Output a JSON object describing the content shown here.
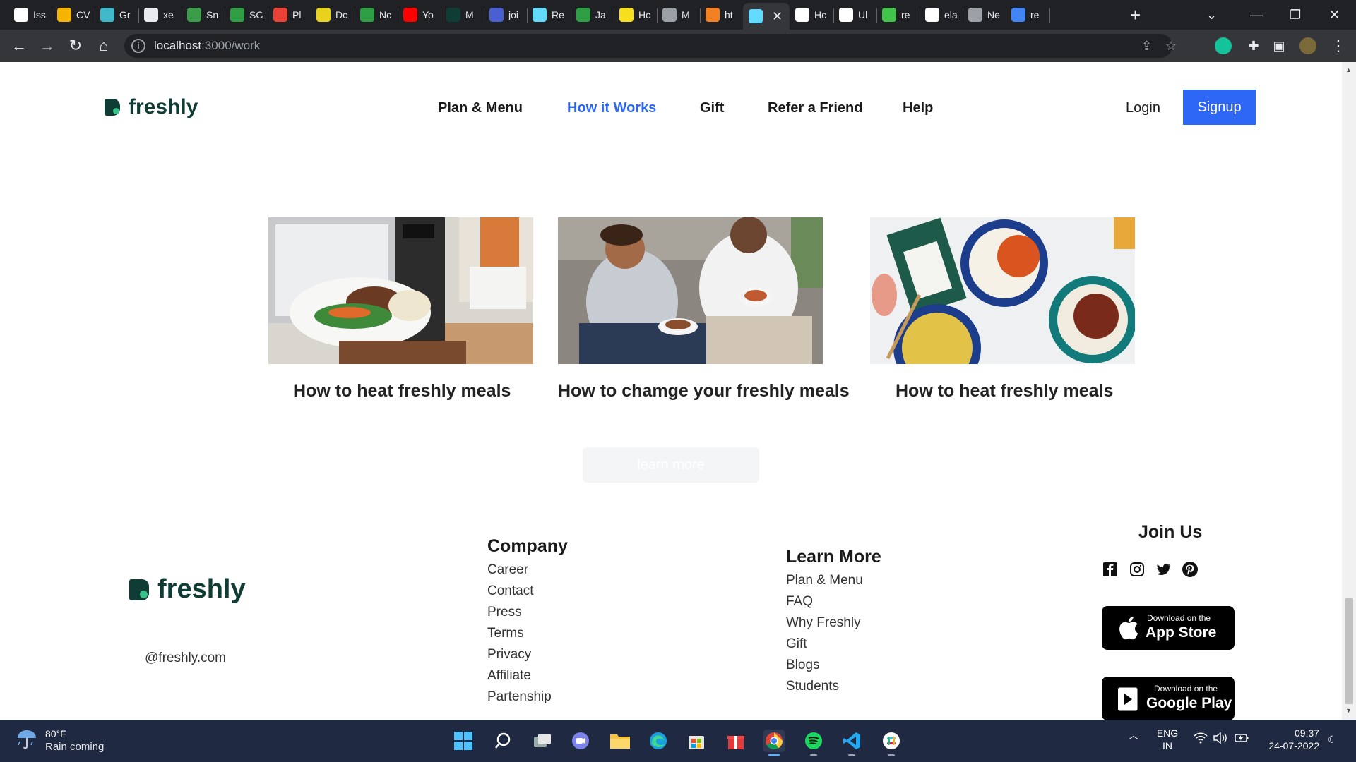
{
  "browser": {
    "tabs": [
      {
        "label": "Iss",
        "icon": "github-icon",
        "color": "#ffffff"
      },
      {
        "label": "CV",
        "icon": "hourglass-icon",
        "color": "#f4b400"
      },
      {
        "label": "Gr",
        "icon": "bolt-icon",
        "color": "#3fb8c9"
      },
      {
        "label": "xe",
        "icon": "square-icon",
        "color": "#e8eaed"
      },
      {
        "label": "Sn",
        "icon": "map-icon",
        "color": "#3b9c4a"
      },
      {
        "label": "SC",
        "icon": "w-icon",
        "color": "#2e9d43"
      },
      {
        "label": "Pl",
        "icon": "gmail-icon",
        "color": "#ea4335"
      },
      {
        "label": "Dc",
        "icon": "download-icon",
        "color": "#e8d21d"
      },
      {
        "label": "Nc",
        "icon": "w-icon",
        "color": "#2e9d43"
      },
      {
        "label": "Yo",
        "icon": "youtube-icon",
        "color": "#ff0000"
      },
      {
        "label": "M",
        "icon": "freshly-icon",
        "color": "#0f3d35"
      },
      {
        "label": "joi",
        "icon": "wifi-icon",
        "color": "#4a5fd1"
      },
      {
        "label": "Re",
        "icon": "react-icon",
        "color": "#61dafb"
      },
      {
        "label": "Ja",
        "icon": "w-icon",
        "color": "#2e9d43"
      },
      {
        "label": "Hc",
        "icon": "js-icon",
        "color": "#f7df1e"
      },
      {
        "label": "M",
        "icon": "globe-icon",
        "color": "#9aa0a6"
      },
      {
        "label": "ht",
        "icon": "stack-icon",
        "color": "#f48024"
      },
      {
        "label": "",
        "icon": "react-icon",
        "color": "#61dafb",
        "active": true
      },
      {
        "label": "Hc",
        "icon": "medium-icon",
        "color": "#ffffff"
      },
      {
        "label": "Ul",
        "icon": "github-icon",
        "color": "#ffffff"
      },
      {
        "label": "re",
        "icon": "spark-icon",
        "color": "#42c44b"
      },
      {
        "label": "ela",
        "icon": "github-icon",
        "color": "#ffffff"
      },
      {
        "label": "Ne",
        "icon": "chrome-icon",
        "color": "#9aa0a6"
      },
      {
        "label": "re",
        "icon": "google-icon",
        "color": "#4285f4"
      }
    ],
    "url_host": "localhost",
    "url_path": ":3000/work"
  },
  "site": {
    "brand": "freshly",
    "nav": [
      "Plan & Menu",
      "How it Works",
      "Gift",
      "Refer a Friend",
      "Help"
    ],
    "current_nav": "How it Works",
    "login": "Login",
    "signup": "Signup"
  },
  "cards": [
    {
      "title": "How to heat freshly meals"
    },
    {
      "title": "How to chamge your freshly meals"
    },
    {
      "title": "How to heat freshly meals"
    }
  ],
  "learn_more": "learn more",
  "footer": {
    "brand": "freshly",
    "email": "@freshly.com",
    "company": {
      "heading": "Company",
      "links": [
        "Career",
        "Contact",
        "Press",
        "Terms",
        "Privacy",
        "Affiliate",
        "Partenship"
      ]
    },
    "learn_more": {
      "heading": "Learn More",
      "links": [
        "Plan & Menu",
        "FAQ",
        "Why Freshly",
        "Gift",
        "Blogs",
        "Students"
      ]
    },
    "join": {
      "heading": "Join Us",
      "social": [
        "facebook-icon",
        "instagram-icon",
        "twitter-icon",
        "pinterest-icon"
      ],
      "app_store": {
        "small": "Download on the",
        "big": "App Store"
      },
      "google_play": {
        "small": "Download on the",
        "big": "Google Play"
      }
    }
  },
  "taskbar": {
    "weather_temp": "80°F",
    "weather_desc": "Rain coming",
    "lang_line1": "ENG",
    "lang_line2": "IN",
    "time": "09:37",
    "date": "24-07-2022"
  },
  "colors": {
    "brand_dark": "#0f3d35",
    "brand_green": "#36c48a",
    "accent_blue": "#2e67f5"
  }
}
